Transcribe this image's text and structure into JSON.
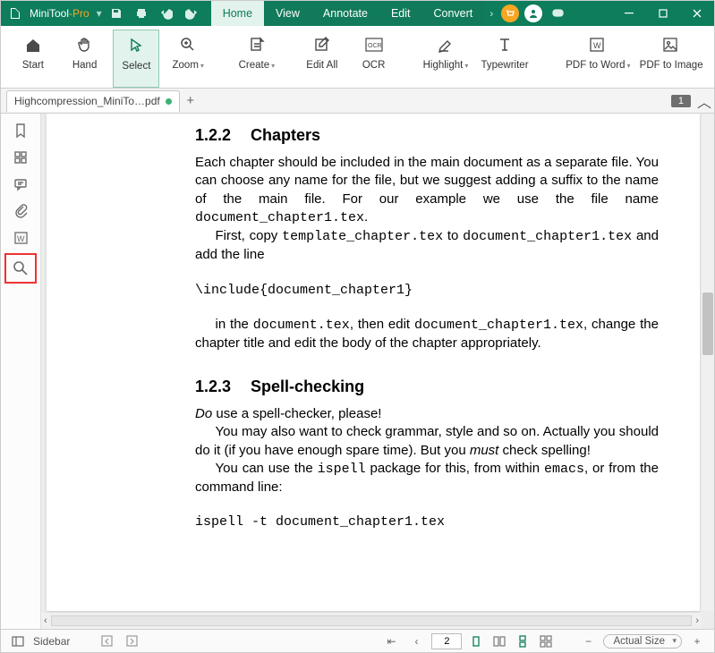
{
  "app": {
    "name": "MiniTool",
    "suffix": "-Pro"
  },
  "menu": [
    "Home",
    "View",
    "Annotate",
    "Edit",
    "Convert"
  ],
  "menu_active": 0,
  "ribbon": [
    {
      "id": "start",
      "label": "Start"
    },
    {
      "id": "hand",
      "label": "Hand"
    },
    {
      "id": "select",
      "label": "Select",
      "selected": true
    },
    {
      "id": "zoom",
      "label": "Zoom",
      "dd": true
    },
    {
      "id": "create",
      "label": "Create",
      "dd": true
    },
    {
      "id": "editall",
      "label": "Edit All"
    },
    {
      "id": "ocr",
      "label": "OCR"
    },
    {
      "id": "highlight",
      "label": "Highlight",
      "dd": true
    },
    {
      "id": "typewriter",
      "label": "Typewriter"
    },
    {
      "id": "pdfword",
      "label": "PDF to Word",
      "dd": true,
      "wide": true
    },
    {
      "id": "pdfimage",
      "label": "PDF to Image",
      "wide": true
    }
  ],
  "tab": {
    "name": "Highcompression_MiniTo…pdf",
    "page_badge": "1"
  },
  "sidebar_label": "Sidebar",
  "status": {
    "current_page": "2",
    "zoom": "Actual Size"
  },
  "doc": {
    "s1_num": "1.2.2",
    "s1_title": "Chapters",
    "s1_p1a": "Each chapter should be included in the main document as a separate file.  You can choose any name for the file, but we suggest adding a suffix to the name of the main file. For our example we use the file name ",
    "s1_p1b": "document_chapter1.tex",
    "s1_p2a": "First, copy ",
    "s1_p2b": "template_chapter.tex",
    "s1_p2c": " to ",
    "s1_p2d": "document_chapter1.tex",
    "s1_p2e": " and add the line",
    "s1_code1": "\\include{document_chapter1}",
    "s1_p3a": "in the ",
    "s1_p3b": "document.tex",
    "s1_p3c": ", then edit ",
    "s1_p3d": "document_chapter1.tex",
    "s1_p3e": ", change the chapter title and edit the body of the chapter appropriately.",
    "s2_num": "1.2.3",
    "s2_title": "Spell-checking",
    "s2_p1a": "Do",
    "s2_p1b": " use a spell-checker, please!",
    "s2_p2a": "You may also want to check grammar, style and so on.  Actually you should do it (if you have enough spare time). But you ",
    "s2_p2b": "must",
    "s2_p2c": " check spelling!",
    "s2_p3a": "You can use the ",
    "s2_p3b": "ispell",
    "s2_p3c": " package for this, from within ",
    "s2_p3d": "emacs",
    "s2_p3e": ", or from the command line:",
    "s2_code1": "ispell -t document_chapter1.tex"
  }
}
